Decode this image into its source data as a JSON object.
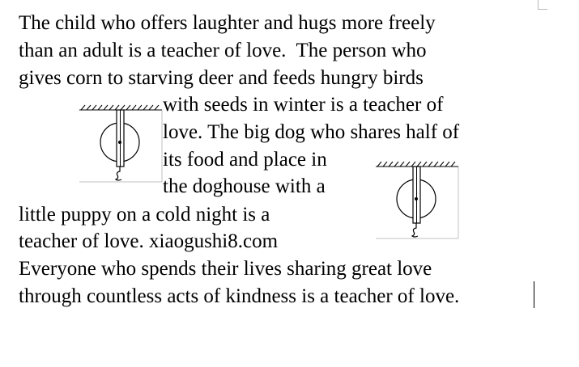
{
  "document": {
    "lines": [
      "The child who offers laughter and hugs more freely",
      "than an adult is a teacher of love.  The person who",
      "gives corn to starving deer and feeds hungry birds",
      "with seeds in winter is a teacher of",
      "love. The big dog who shares half of",
      "its food and place in",
      "the doghouse with a",
      "little puppy on a cold night is a",
      "teacher of love. xiaogushi8.com",
      "Everyone who spends their lives sharing great love",
      "through countless acts of kindness is a teacher of love."
    ]
  },
  "figures": [
    {
      "icon": "pulley-diagram-icon"
    },
    {
      "icon": "pulley-diagram-icon"
    }
  ],
  "colors": {
    "text": "#000000",
    "background": "#ffffff",
    "diagram_line": "#000000",
    "wrap_frame": "#c0c0c0"
  }
}
